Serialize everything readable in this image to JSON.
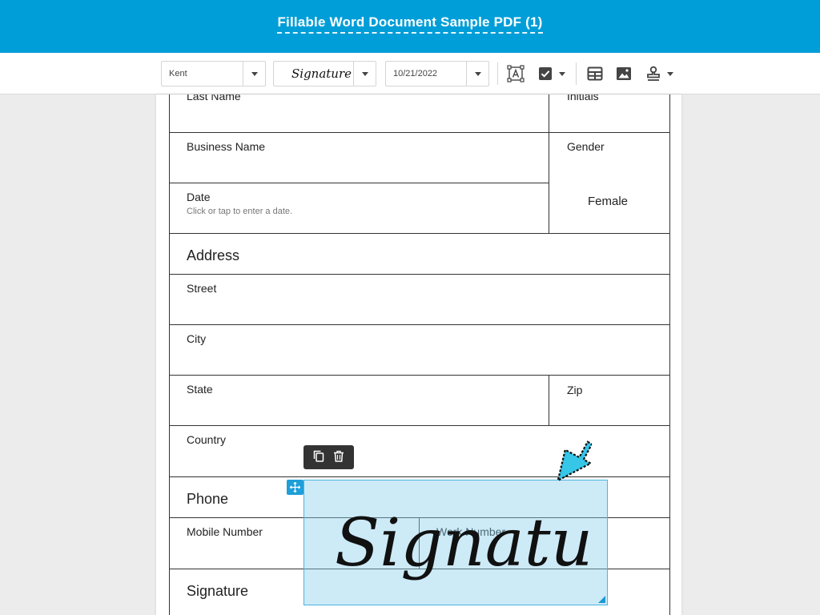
{
  "header": {
    "title": "Fillable Word Document Sample PDF (1)"
  },
  "toolbar": {
    "font_select": {
      "value": "Kent"
    },
    "signature_select": {
      "value": "Signature"
    },
    "date_select": {
      "value": "10/21/2022"
    },
    "icons": [
      "text-field-icon",
      "checkbox-icon",
      "table-icon",
      "image-icon",
      "stamp-icon"
    ]
  },
  "form": {
    "last_name_label": "Last Name",
    "initials_label": "Initials",
    "business_name_label": "Business Name",
    "gender_label": "Gender",
    "gender_value": "Female",
    "date_label": "Date",
    "date_hint": "Click or tap to enter a date.",
    "address_heading": "Address",
    "street_label": "Street",
    "city_label": "City",
    "state_label": "State",
    "zip_label": "Zip",
    "country_label": "Country",
    "phone_heading": "Phone",
    "mobile_label": "Mobile Number",
    "work_label": "Work Number",
    "signature_heading": "Signature"
  },
  "signature_field": {
    "text": "Signature",
    "actions": [
      "copy-icon",
      "trash-icon"
    ]
  },
  "colors": {
    "accent": "#009ed8",
    "field_fill": "#cde9f6",
    "field_border": "#4ab4e0",
    "cursor": "#35c6e8"
  }
}
